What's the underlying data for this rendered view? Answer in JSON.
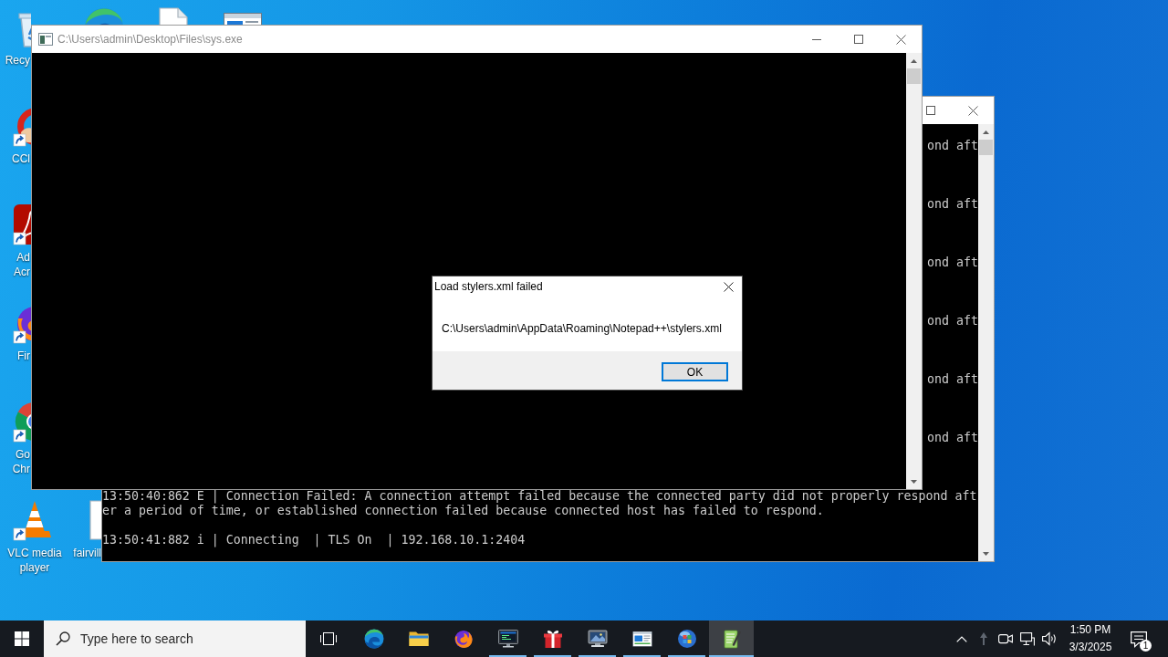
{
  "desktop": {
    "icons": [
      {
        "kind": "recycle-bin",
        "shortcut": false,
        "label": [
          "Recy"
        ]
      },
      {
        "kind": "edge"
      },
      {
        "kind": "document"
      },
      {
        "kind": "window"
      },
      {
        "kind": "ccleaner",
        "shortcut": true,
        "label": [
          "CCl"
        ]
      },
      {
        "kind": "acrobat",
        "shortcut": true,
        "label": [
          "Ad",
          "Acr"
        ]
      },
      {
        "kind": "firefox",
        "shortcut": true,
        "label": [
          "Fir"
        ]
      },
      {
        "kind": "chrome",
        "shortcut": true,
        "label": [
          "Go",
          "Chr"
        ]
      },
      {
        "kind": "vlc",
        "shortcut": true,
        "label": [
          "VLC media",
          "player"
        ]
      },
      {
        "kind": "document",
        "shortcut": false,
        "label": [
          "fairvill"
        ]
      }
    ]
  },
  "console_window": {
    "title": "C:\\Users\\admin\\Desktop\\Files\\sys.exe"
  },
  "dialog": {
    "title": "Load stylers.xml failed",
    "message": "C:\\Users\\admin\\AppData\\Roaming\\Notepad++\\stylers.xml",
    "buttons": [
      {
        "label": "OK",
        "default": true
      }
    ]
  },
  "background_console": {
    "log": [
      {
        "kind": "error-tail",
        "text": "ond aft"
      },
      {
        "kind": "error-tail",
        "text": "ond aft"
      },
      {
        "kind": "error-tail",
        "text": "ond aft"
      },
      {
        "kind": "error-tail",
        "text": "ond aft"
      },
      {
        "kind": "error-tail",
        "text": "ond aft"
      },
      {
        "kind": "error-tail",
        "text": "ond aft"
      },
      {
        "kind": "error",
        "lines": [
          "13:50:40:862 E | Connection Failed: A connection attempt failed because the connected party did not properly respond aft",
          "er a period of time, or established connection failed because connected host has failed to respond."
        ]
      },
      {
        "kind": "info",
        "text": "13:50:41:882 i | Connecting  | TLS On  | 192.168.10.1:2404"
      }
    ]
  },
  "taskbar": {
    "search": {
      "placeholder": "Type here to search"
    },
    "apps": [
      {
        "kind": "edge",
        "running": false,
        "selected": false
      },
      {
        "kind": "folder",
        "running": false,
        "selected": false
      },
      {
        "kind": "firefox",
        "running": false,
        "selected": false
      },
      {
        "kind": "monitor",
        "running": true,
        "selected": false
      },
      {
        "kind": "gift",
        "running": true,
        "selected": false
      },
      {
        "kind": "computer",
        "running": true,
        "selected": false
      },
      {
        "kind": "window",
        "running": true,
        "selected": false
      },
      {
        "kind": "globe",
        "running": true,
        "selected": false
      },
      {
        "kind": "notepad",
        "running": true,
        "selected": true
      }
    ],
    "clock": {
      "time": "1:50 PM",
      "date": "3/3/2025"
    },
    "notifications": {
      "count": "1"
    }
  }
}
